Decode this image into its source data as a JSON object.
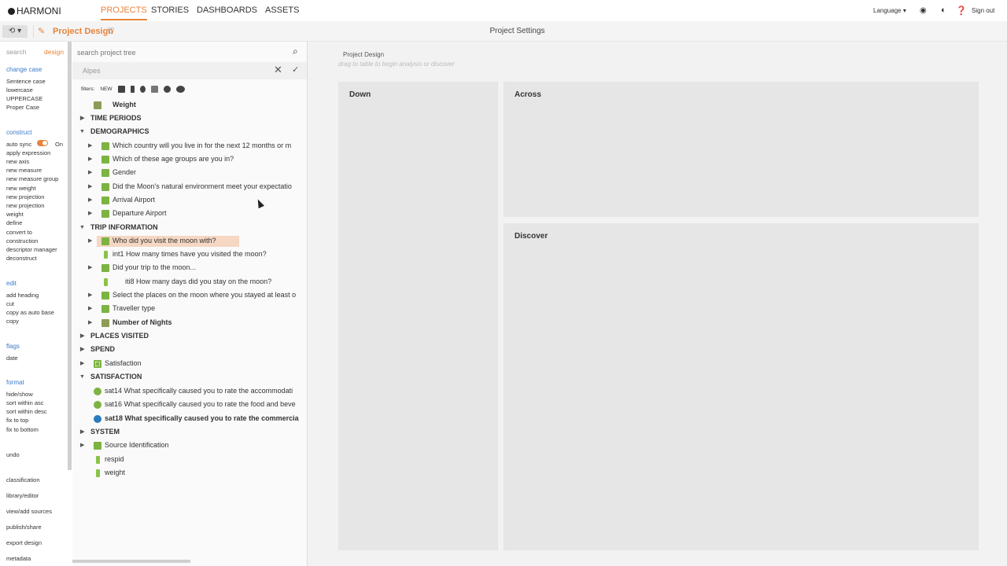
{
  "app": {
    "logo": "HARMONI"
  },
  "nav": {
    "projects": "PROJECTS",
    "stories": "STORIES",
    "dashboards": "DASHBOARDS",
    "assets": "ASSETS"
  },
  "topright": {
    "language": "Language ▾",
    "signout": "Sign out"
  },
  "subbar": {
    "project_title": "Project Design",
    "settings": "Project Settings"
  },
  "leftmenu": {
    "tab_search": "search",
    "tab_design": "design",
    "change_case": "change case",
    "sentence": "Sentence case",
    "lower": "lowercase",
    "upper": "UPPERCASE",
    "proper": "Proper Case",
    "construct": "construct",
    "autosync": "auto sync",
    "on": "On",
    "apply_expression": "apply expression",
    "new_axis": "new axis",
    "new_measure": "new measure",
    "new_measure_group": "new measure group",
    "new_weight": "new weight",
    "new_projection1": "new projection",
    "new_projection2": "new projection",
    "weight": "weight",
    "define": "define",
    "convert_to": "convert to",
    "construction": "construction",
    "descriptor_manager": "descriptor manager",
    "deconstruct": "deconstruct",
    "edit": "edit",
    "add_heading": "add heading",
    "cut": "cut",
    "copy_as_auto_base": "copy as auto base",
    "copy": "copy",
    "flags": "flags",
    "date": "date",
    "format": "format",
    "hide_show": "hide/show",
    "sort_asc": "sort within asc",
    "sort_desc": "sort within desc",
    "fix_top": "fix to top",
    "fix_bottom": "fix to bottom",
    "undo": "undo",
    "classification": "classification",
    "library_editor": "library/editor",
    "view_add_sources": "view/add sources",
    "publish_share": "publish/share",
    "export_design": "export design",
    "metadata": "metadata"
  },
  "tree": {
    "search_placeholder": "search project tree",
    "filter_value": "Alpes",
    "filters_label": "filters:",
    "filters_new": "NEW",
    "rows": [
      "Weight",
      "TIME PERIODS",
      "DEMOGRAPHICS",
      "Which country will you live in for the next 12 months or m",
      "Which of these age groups are you in?",
      "Gender",
      "Did the Moon's natural environment meet your expectatio",
      "Arrival Airport",
      "Departure Airport",
      "TRIP INFORMATION",
      "Who did you visit the moon with?",
      "int1 How many times have you visited the moon?",
      "Did your trip to the moon...",
      "iti8 How many days did you stay on the moon?",
      "Select the places on the moon where you stayed at least o",
      "Traveller type",
      "Number of Nights",
      "PLACES VISITED",
      "SPEND",
      "Satisfaction",
      "SATISFACTION",
      "sat14 What specifically caused you to rate the accommodati",
      "sat16 What specifically caused you to rate the food and beve",
      "sat18 What specifically caused you to rate the commercia",
      "SYSTEM",
      "Source Identification",
      "respid",
      "weight"
    ]
  },
  "main": {
    "title": "Project Design",
    "hint": "drag to table to begin analysis or discover",
    "down": "Down",
    "across": "Across",
    "discover": "Discover"
  }
}
